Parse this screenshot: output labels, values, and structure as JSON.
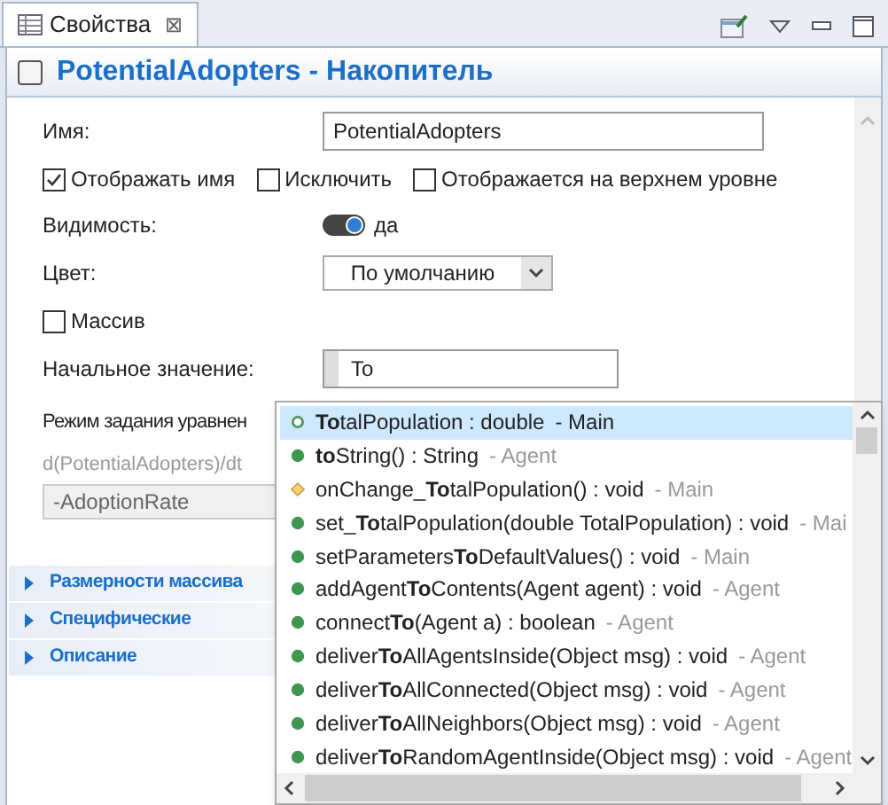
{
  "tab": {
    "label": "Свойства",
    "close": "⊠"
  },
  "header": {
    "title": "PotentialAdopters - Накопитель"
  },
  "name_field": {
    "label": "Имя:",
    "value": "PotentialAdopters"
  },
  "checkboxes": [
    {
      "label": "Отображать имя",
      "checked": true
    },
    {
      "label": "Исключить",
      "checked": false
    },
    {
      "label": "Отображается на верхнем уровне",
      "checked": false
    }
  ],
  "visibility": {
    "label": "Видимость:",
    "on": true,
    "value": "да"
  },
  "color": {
    "label": "Цвет:",
    "value": "По умолчанию"
  },
  "array": {
    "label": "Массив",
    "checked": false
  },
  "initial": {
    "label": "Начальное значение:",
    "value": "To"
  },
  "mode": {
    "label": "Режим задания уравнен"
  },
  "equation": {
    "label": "d(PotentialAdopters)/dt",
    "value": "-AdoptionRate"
  },
  "sections": [
    {
      "label": "Размерности массива"
    },
    {
      "label": "Специфические"
    },
    {
      "label": "Описание"
    }
  ],
  "completions": [
    {
      "kind": "field",
      "text": "**To**talPopulation : double",
      "origin": "- Main",
      "selected": true
    },
    {
      "kind": "method",
      "text": "**to**String() : String",
      "origin": "- Agent",
      "selected": false
    },
    {
      "kind": "handler",
      "text": "onChange_**To**talPopulation() : void",
      "origin": "- Main",
      "selected": false
    },
    {
      "kind": "method",
      "text": "set_**To**talPopulation(double TotalPopulation) : void",
      "origin": "- Mai",
      "selected": false
    },
    {
      "kind": "method",
      "text": "setParameters**To**DefaultValues() : void",
      "origin": "- Main",
      "selected": false
    },
    {
      "kind": "method",
      "text": "addAgent**To**Contents(Agent agent) : void",
      "origin": "- Agent",
      "selected": false
    },
    {
      "kind": "method",
      "text": "connect**To**(Agent a) : boolean",
      "origin": "- Agent",
      "selected": false
    },
    {
      "kind": "method",
      "text": "deliver**To**AllAgentsInside(Object msg) : void",
      "origin": "- Agent",
      "selected": false
    },
    {
      "kind": "method",
      "text": "deliver**To**AllConnected(Object msg) : void",
      "origin": "- Agent",
      "selected": false
    },
    {
      "kind": "method",
      "text": "deliver**To**AllNeighbors(Object msg) : void",
      "origin": "- Agent",
      "selected": false
    },
    {
      "kind": "method",
      "text": "deliver**To**RandomAgentInside(Object msg) : void",
      "origin": "- Agent",
      "selected": false
    }
  ]
}
